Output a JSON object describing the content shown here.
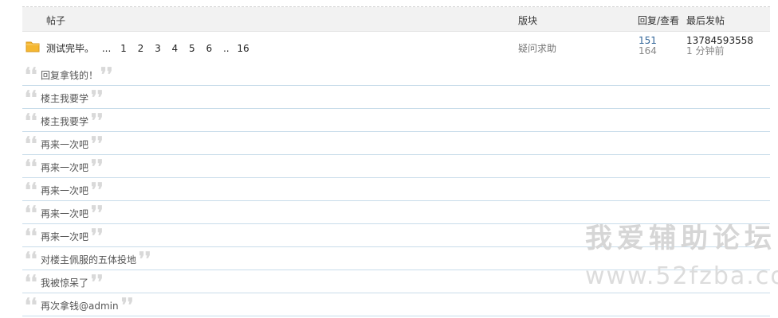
{
  "header": {
    "topic": "帖子",
    "forum": "版块",
    "stats": "回复/查看",
    "last_post": "最后发帖"
  },
  "thread": {
    "title": "测试完毕。",
    "ellipsis": "...",
    "pages": [
      "1",
      "2",
      "3",
      "4",
      "5",
      "6"
    ],
    "sep": "..",
    "last_page": "16",
    "forum": "疑问求助",
    "replies": "151",
    "views": "164",
    "last_user": "13784593558",
    "last_time": "1 分钟前"
  },
  "quotes": [
    {
      "text": "回复拿钱的！"
    },
    {
      "text": "楼主我要学"
    },
    {
      "text": "楼主我要学"
    },
    {
      "text": "再来一次吧"
    },
    {
      "text": "再来一次吧"
    },
    {
      "text": "再来一次吧"
    },
    {
      "text": "再来一次吧"
    },
    {
      "text": "再来一次吧"
    },
    {
      "text": "对楼主佩服的五体投地"
    },
    {
      "text": "我被惊呆了"
    },
    {
      "text": "再次拿钱@admin"
    }
  ],
  "quote_open": "❛❛",
  "quote_close": "❜❜",
  "watermark": {
    "name": "我爱辅助论坛",
    "url": "www.52fzba.com"
  },
  "colors": {
    "folder": "#f5b731",
    "divider": "#c8dcea",
    "reply_count": "#336699"
  },
  "icons": {
    "folder": "folder-icon"
  }
}
